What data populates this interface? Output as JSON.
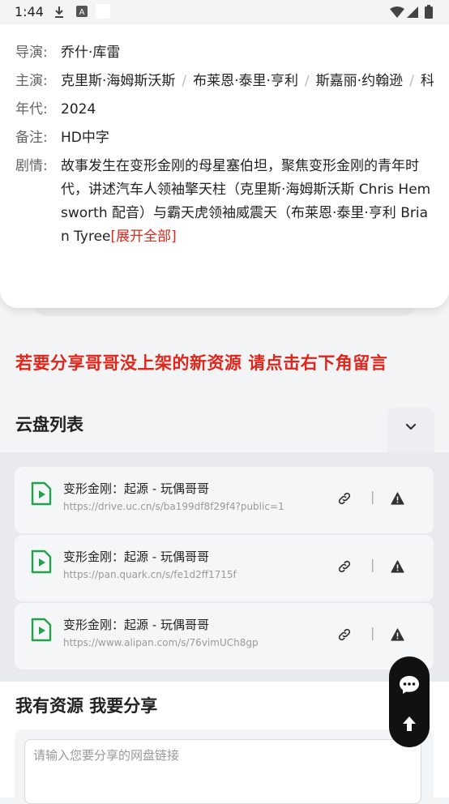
{
  "status_bar": {
    "time": "1:44"
  },
  "info": {
    "director": {
      "label": "导演:",
      "value": "乔什·库雷"
    },
    "cast": {
      "label": "主演:",
      "names": [
        "克里斯·海姆斯沃斯",
        "布莱恩·泰里·亨利",
        "斯嘉丽·约翰逊",
        "科..."
      ]
    },
    "year": {
      "label": "年代:",
      "value": "2024"
    },
    "note": {
      "label": "备注:",
      "value": "HD中字"
    },
    "plot": {
      "label": "剧情:",
      "text": "故事发生在变形金刚的母星塞伯坦，聚焦变形金刚的青年时代，讲述汽车人领袖擎天柱（克里斯·海姆斯沃斯 Chris Hemsworth 配音）与霸天虎领袖威震天（布莱恩·泰里·亨利 Brian Tyree",
      "expand_label": "[展开全部]"
    }
  },
  "notice": "若要分享哥哥没上架的新资源 请点击右下角留言",
  "cloud_list": {
    "title": "云盘列表",
    "items": [
      {
        "title": "变形金刚：起源 - 玩偶哥哥",
        "url": "https://drive.uc.cn/s/ba199df8f29f4?public=1"
      },
      {
        "title": "变形金刚：起源 - 玩偶哥哥",
        "url": "https://pan.quark.cn/s/fe1d2ff1715f"
      },
      {
        "title": "变形金刚：起源 - 玩偶哥哥",
        "url": "https://www.alipan.com/s/76vimUCh8gp"
      }
    ]
  },
  "share": {
    "title": "我有资源 我要分享",
    "placeholder": "请输入您要分享的网盘链接"
  },
  "colors": {
    "accent_red": "#e0261b",
    "file_green": "#22a34a",
    "fab_bg": "#111111"
  },
  "icons": {
    "file": "play-file-icon",
    "link": "link-icon",
    "warn": "warning-icon",
    "toggle": "chevron-down-icon",
    "chat": "chat-icon",
    "top": "arrow-up-icon"
  }
}
